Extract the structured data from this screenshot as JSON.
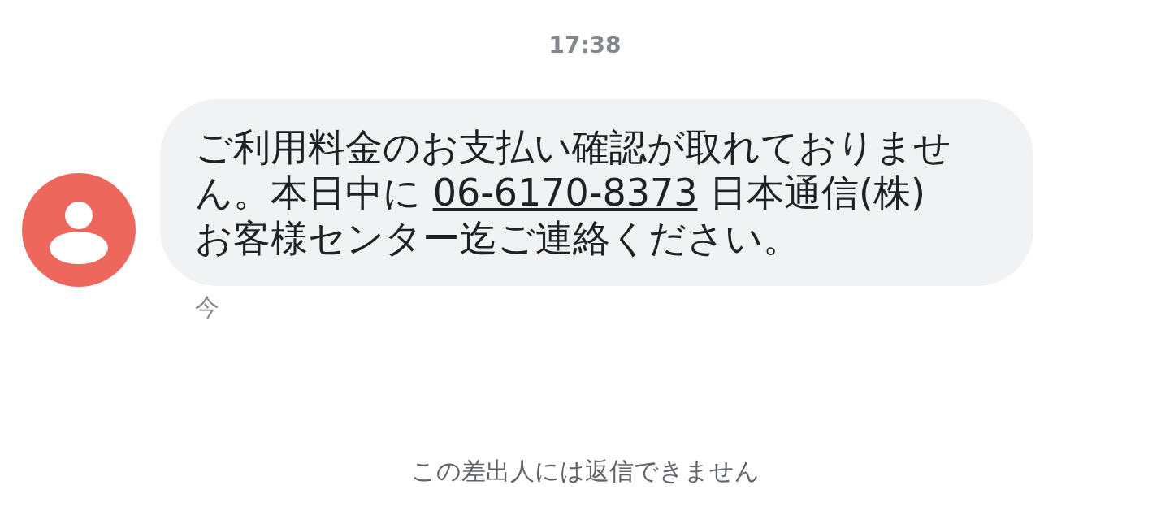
{
  "timestamp": "17:38",
  "message": {
    "text_before": "ご利用料金のお支払い確認が取れておりません。本日中に ",
    "link": "06-6170-8373",
    "text_after": " 日本通信(株) お客様センター迄ご連絡ください。",
    "time": "今"
  },
  "footer": "この差出人には返信できません"
}
